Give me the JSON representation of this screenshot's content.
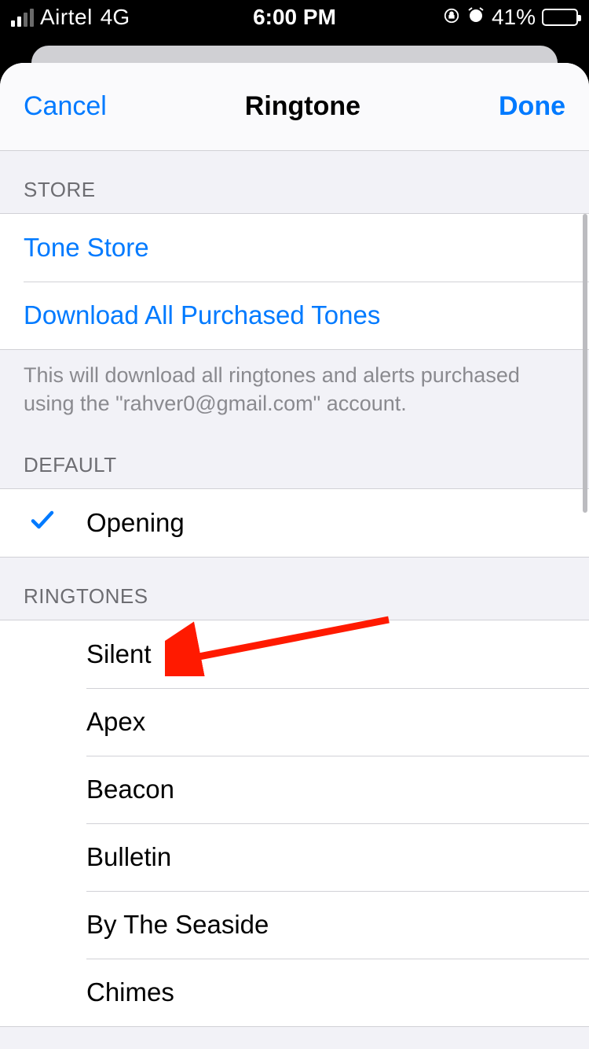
{
  "status": {
    "carrier": "Airtel",
    "network": "4G",
    "time": "6:00 PM",
    "battery_pct": "41%"
  },
  "nav": {
    "cancel": "Cancel",
    "title": "Ringtone",
    "done": "Done"
  },
  "sections": {
    "store_header": "STORE",
    "tone_store": "Tone Store",
    "download_all": "Download All Purchased Tones",
    "download_footer": "This will download all ringtones and alerts purchased using the \"rahver0@gmail.com\" account.",
    "default_header": "DEFAULT",
    "default_item": "Opening",
    "ringtones_header": "RINGTONES",
    "ringtones": [
      "Silent",
      "Apex",
      "Beacon",
      "Bulletin",
      "By The Seaside",
      "Chimes"
    ]
  }
}
